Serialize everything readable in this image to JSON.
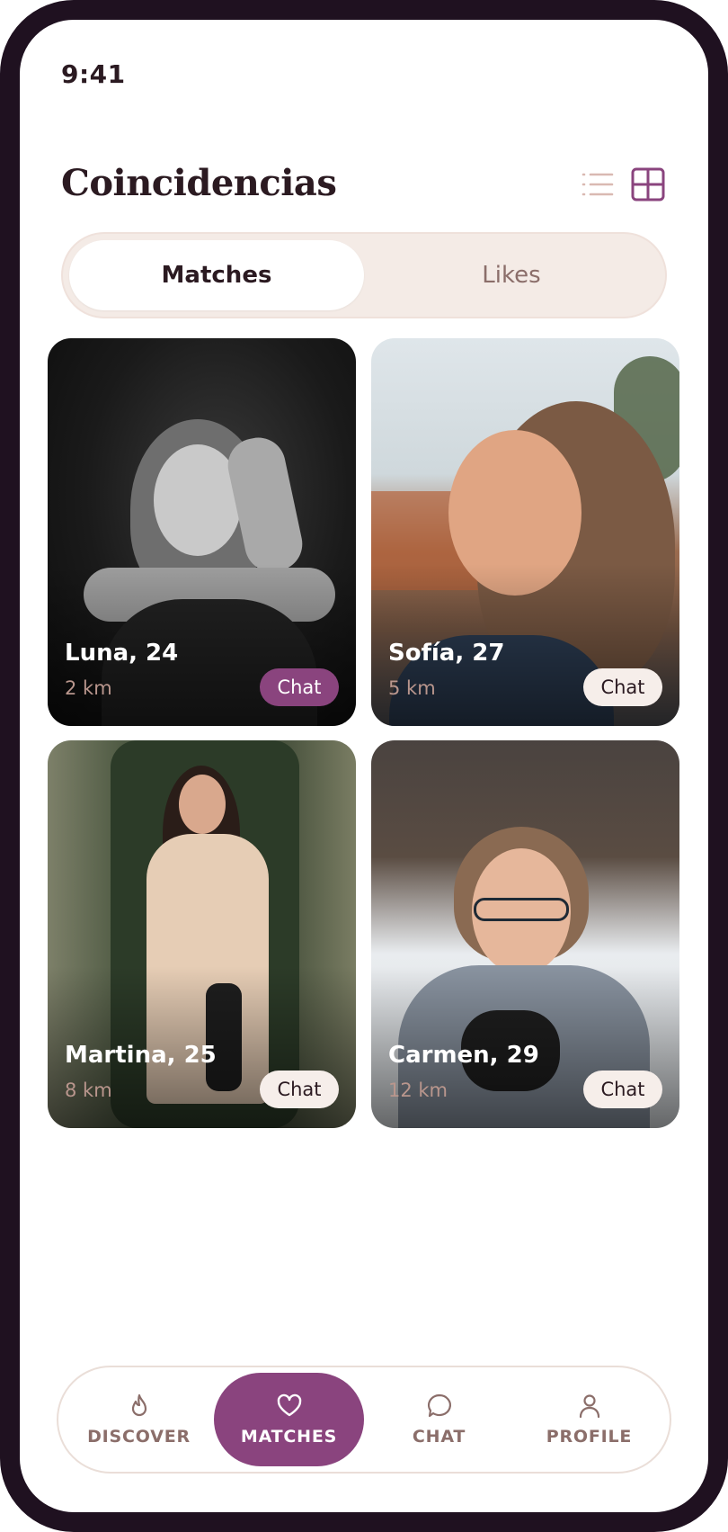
{
  "status_bar": {
    "time": "9:41"
  },
  "header": {
    "title": "Coincidencias",
    "view_modes": [
      {
        "name": "list",
        "icon": "list-icon",
        "active": false
      },
      {
        "name": "grid",
        "icon": "grid-icon",
        "active": true
      }
    ]
  },
  "tabs": [
    {
      "label": "Matches",
      "active": true
    },
    {
      "label": "Likes",
      "active": false
    }
  ],
  "matches": [
    {
      "name_age": "Luna, 24",
      "distance": "2 km",
      "chat_label": "Chat",
      "chat_style": "primary"
    },
    {
      "name_age": "Sofía, 27",
      "distance": "5 km",
      "chat_label": "Chat",
      "chat_style": "light"
    },
    {
      "name_age": "Martina, 25",
      "distance": "8 km",
      "chat_label": "Chat",
      "chat_style": "light"
    },
    {
      "name_age": "Carmen, 29",
      "distance": "12 km",
      "chat_label": "Chat",
      "chat_style": "light"
    }
  ],
  "bottom_nav": [
    {
      "label": "DISCOVER",
      "icon": "flame-icon",
      "active": false
    },
    {
      "label": "MATCHES",
      "icon": "heart-icon",
      "active": true
    },
    {
      "label": "CHAT",
      "icon": "chat-bubble-icon",
      "active": false
    },
    {
      "label": "PROFILE",
      "icon": "person-icon",
      "active": false
    }
  ],
  "colors": {
    "frame": "#1f1120",
    "accent": "#8a447e",
    "text_dark": "#2b1a21",
    "text_muted": "#8b6e6a",
    "segment_bg": "#f4ebe6"
  }
}
